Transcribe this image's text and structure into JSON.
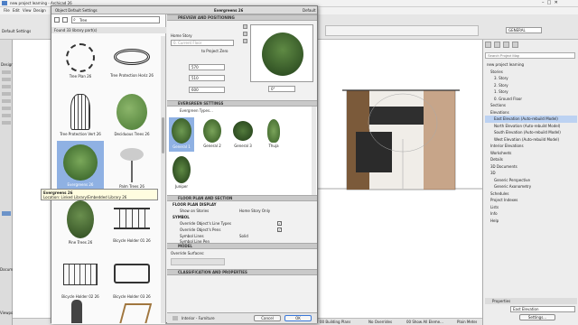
{
  "app": {
    "title": "new project learning - Archicad 26",
    "menu": [
      "File",
      "Edit",
      "View",
      "Design"
    ]
  },
  "toolbar": {
    "settings_label": "Default Settings"
  },
  "canvas_tab": {
    "label": "[0. Story]"
  },
  "toolbox": {
    "design_label": "Design",
    "document_label": "Document",
    "viewpoint_label": "Viewpoint"
  },
  "dialog": {
    "title": "Object Default Settings",
    "search_value": "Tree",
    "found_text": "Found 33 library part(s)",
    "object_name": "Evergreens 26",
    "default_label": "Default",
    "items": [
      {
        "label": "Tree Plan 26"
      },
      {
        "label": "Tree Protection Horiz 26"
      },
      {
        "label": "Tree Protection Vert 26"
      },
      {
        "label": "Deciduous Trees 26"
      },
      {
        "label": "Evergreens 26"
      },
      {
        "label": "Palm Trees 26"
      },
      {
        "label": "Pine Trees 26"
      },
      {
        "label": "Bicycle Holder 01 26"
      },
      {
        "label": "Bicycle Holder 02 26"
      },
      {
        "label": "Bicycle Holder 03 26"
      }
    ],
    "tooltip": {
      "line1": "Evergreens 26",
      "line2": "Location: Linked Library/Embedded Library 26"
    },
    "preview": {
      "section": "PREVIEW AND POSITIONING",
      "home_story_label": "Home Story",
      "home_story_value": "0. Current Floor",
      "to_project_zero": "to Project Zero",
      "v1": "570",
      "v2": "510",
      "v3": "600",
      "angle": "0°"
    },
    "evergreen": {
      "section": "EVERGREEN SETTINGS",
      "dropdown": "Evergreen Types...",
      "types": [
        {
          "label": "General 1"
        },
        {
          "label": "General 2"
        },
        {
          "label": "General 3"
        },
        {
          "label": "Thuja"
        },
        {
          "label": "Juniper"
        }
      ]
    },
    "floorplan": {
      "section": "FLOOR PLAN AND SECTION",
      "display_label": "FLOOR PLAN DISPLAY",
      "show_on_stories": "Show on Stories",
      "show_on_stories_value": "Home Story Only",
      "symbol_label": "SYMBOL",
      "override_line": "Override Object's Line Types",
      "override_pens": "Override Object's Pens",
      "symbol_lines": "Symbol Lines",
      "symbol_lines_value": "Solid",
      "symbol_line_pen": "Symbol Line Pen"
    },
    "model": {
      "section": "MODEL",
      "override_surfaces": "Override Surfaces:"
    },
    "classification": {
      "section": "CLASSIFICATION AND PROPERTIES"
    },
    "layer_value": "Interior - Furniture",
    "cancel": "Cancel",
    "ok": "OK"
  },
  "navigator": {
    "search_placeholder": "Search Project Map",
    "mode": "GENERAL",
    "items": [
      {
        "label": "new project learning",
        "indent": 0
      },
      {
        "label": "Stories",
        "indent": 1
      },
      {
        "label": "3. Story",
        "indent": 2
      },
      {
        "label": "2. Story",
        "indent": 2
      },
      {
        "label": "1. Story",
        "indent": 2
      },
      {
        "label": "0. Ground Floor",
        "indent": 2
      },
      {
        "label": "Sections",
        "indent": 1
      },
      {
        "label": "Elevations",
        "indent": 1
      },
      {
        "label": "East Elevation (Auto-rebuild Model)",
        "indent": 2
      },
      {
        "label": "North Elevation (Auto-rebuild Model)",
        "indent": 2
      },
      {
        "label": "South Elevation (Auto-rebuild Model)",
        "indent": 2
      },
      {
        "label": "West Elevation (Auto-rebuild Model)",
        "indent": 2
      },
      {
        "label": "Interior Elevations",
        "indent": 1
      },
      {
        "label": "Worksheets",
        "indent": 1
      },
      {
        "label": "Details",
        "indent": 1
      },
      {
        "label": "3D Documents",
        "indent": 1
      },
      {
        "label": "3D",
        "indent": 1
      },
      {
        "label": "Generic Perspective",
        "indent": 2
      },
      {
        "label": "Generic Axonometry",
        "indent": 2
      },
      {
        "label": "Schedules",
        "indent": 1
      },
      {
        "label": "Project Indexes",
        "indent": 1
      },
      {
        "label": "Lists",
        "indent": 1
      },
      {
        "label": "Info",
        "indent": 1
      },
      {
        "label": "Help",
        "indent": 1
      }
    ],
    "properties_label": "Properties",
    "prop_value": "East Elevation",
    "settings_btn": "Settings..."
  },
  "status": {
    "a": "00 Building Plans",
    "b": "No Overrides",
    "c": "00 Show All Eleme...",
    "d": "Plain Meter"
  },
  "colors": {
    "accent": "#3b78d8",
    "selected_bg": "#bcd2f2",
    "tree_green": "#3d6b2a"
  }
}
